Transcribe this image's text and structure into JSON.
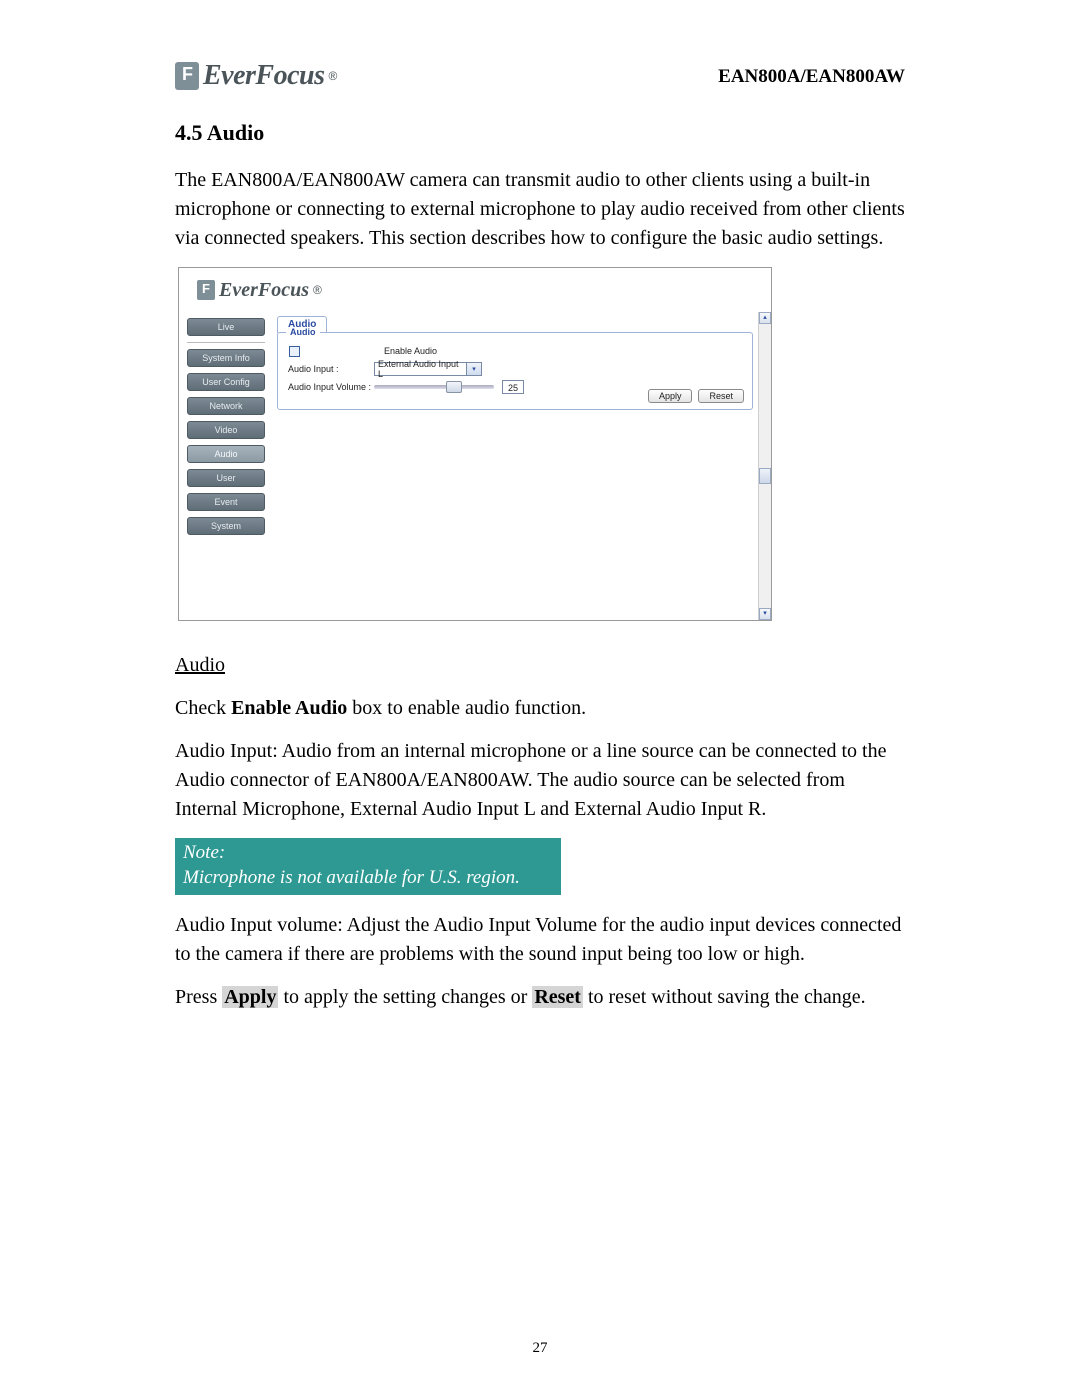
{
  "header": {
    "brand": "EverFocus",
    "model": "EAN800A/EAN800AW"
  },
  "section": {
    "number": "4.5",
    "title": "4.5 Audio",
    "intro": "The EAN800A/EAN800AW camera can transmit audio to other clients using a built-in microphone or connecting to external microphone to play audio received from other clients via connected speakers. This section describes how to configure the basic audio settings."
  },
  "ui": {
    "brand": "EverFocus",
    "sidebar": {
      "live": "Live",
      "system_info": "System Info",
      "user_config": "User Config",
      "network": "Network",
      "video": "Video",
      "audio": "Audio",
      "user": "User",
      "event": "Event",
      "system": "System"
    },
    "tab": "Audio",
    "panel_legend": "Audio",
    "enable_label": "Enable Audio",
    "input_label": "Audio Input :",
    "input_selected": "External Audio Input L",
    "volume_label": "Audio Input Volume :",
    "volume_value": "25",
    "apply": "Apply",
    "reset": "Reset"
  },
  "body": {
    "heading_audio": "Audio",
    "p_enable_pre": "Check ",
    "p_enable_bold": "Enable Audio",
    "p_enable_post": " box to enable audio function.",
    "p_input": "Audio Input: Audio from an internal microphone or a line source can be connected to the Audio connector of EAN800A/EAN800AW. The audio source can be selected from Internal Microphone, External Audio Input L and External Audio Input R.",
    "note_title": "Note:",
    "note_body": "Microphone is not available for U.S. region.",
    "p_volume": "Audio Input volume: Adjust the Audio Input Volume for the audio input devices connected to the camera if there are problems with the sound input being too low or high.",
    "p_apply_1": "Press ",
    "p_apply_b1": "Apply",
    "p_apply_2": " to apply the setting changes or ",
    "p_apply_b2": "Reset",
    "p_apply_3": " to reset without saving the change."
  },
  "page_number": "27"
}
